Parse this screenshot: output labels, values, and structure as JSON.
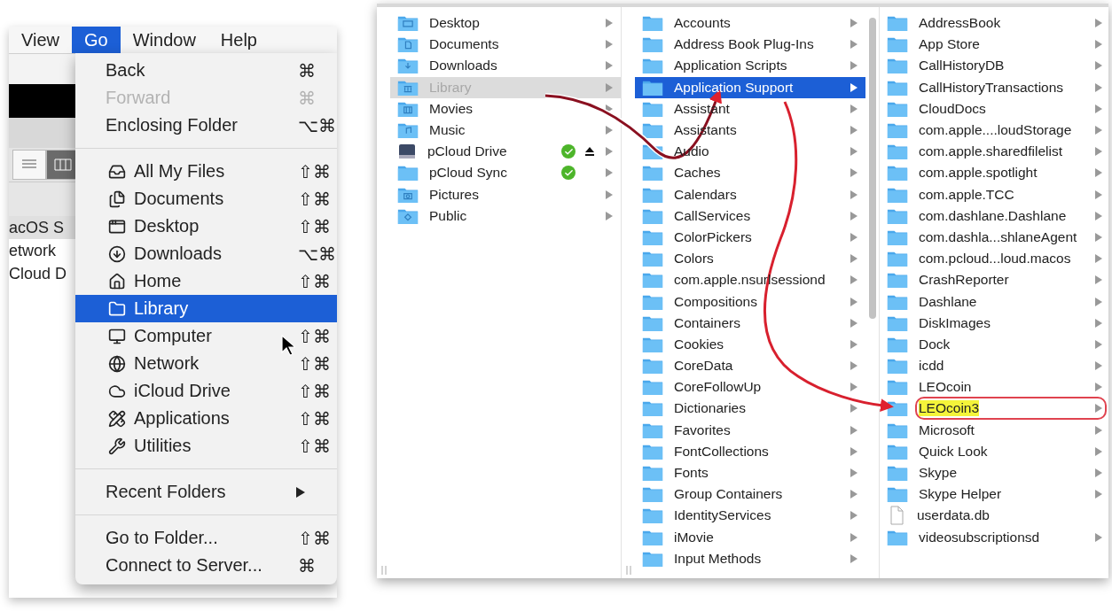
{
  "menu_bar": [
    {
      "label": "View",
      "selected": false
    },
    {
      "label": "Go",
      "selected": true
    },
    {
      "label": "Window",
      "selected": false
    },
    {
      "label": "Help",
      "selected": false
    }
  ],
  "background_window": {
    "view_buttons": [
      {
        "kind": "list",
        "selected": false
      },
      {
        "kind": "columns",
        "selected": true
      }
    ],
    "sidebar": [
      {
        "label": "acOS S",
        "selected": true
      },
      {
        "label": "etwork",
        "selected": false
      },
      {
        "label": "Cloud D",
        "selected": false
      }
    ]
  },
  "go_menu": {
    "sections": [
      [
        {
          "label": "Back",
          "shortcut": "⌘",
          "selected": false,
          "disabled": false,
          "submenu": false
        },
        {
          "label": "Forward",
          "shortcut": "⌘",
          "selected": false,
          "disabled": true,
          "submenu": false
        },
        {
          "label": "Enclosing Folder",
          "shortcut": "⌥⌘",
          "selected": false,
          "disabled": false,
          "submenu": false
        }
      ],
      [
        {
          "label": "All My Files",
          "shortcut": "⇧⌘",
          "selected": false,
          "disabled": false,
          "submenu": false
        },
        {
          "label": "Documents",
          "shortcut": "⇧⌘",
          "selected": false,
          "disabled": false,
          "submenu": false
        },
        {
          "label": "Desktop",
          "shortcut": "⇧⌘",
          "selected": false,
          "disabled": false,
          "submenu": false
        },
        {
          "label": "Downloads",
          "shortcut": "⌥⌘",
          "selected": false,
          "disabled": false,
          "submenu": false
        },
        {
          "label": "Home",
          "shortcut": "⇧⌘",
          "selected": false,
          "disabled": false,
          "submenu": false
        },
        {
          "label": "Library",
          "selected": true,
          "disabled": false,
          "submenu": false
        },
        {
          "label": "Computer",
          "shortcut": "⇧⌘",
          "selected": false,
          "disabled": false,
          "submenu": false
        },
        {
          "label": "Network",
          "shortcut": "⇧⌘",
          "selected": false,
          "disabled": false,
          "submenu": false
        },
        {
          "label": "iCloud Drive",
          "shortcut": "⇧⌘",
          "selected": false,
          "disabled": false,
          "submenu": false
        },
        {
          "label": "Applications",
          "shortcut": "⇧⌘",
          "selected": false,
          "disabled": false,
          "submenu": false
        },
        {
          "label": "Utilities",
          "shortcut": "⇧⌘",
          "selected": false,
          "disabled": false,
          "submenu": false
        }
      ],
      [
        {
          "label": "Recent Folders",
          "selected": false,
          "disabled": false,
          "submenu": true
        }
      ],
      [
        {
          "label": "Go to Folder...",
          "shortcut": "⇧⌘",
          "selected": false,
          "disabled": false,
          "submenu": false
        },
        {
          "label": "Connect to Server...",
          "shortcut": "⌘",
          "selected": false,
          "disabled": false,
          "submenu": false
        }
      ]
    ]
  },
  "finder_columns": [
    {
      "focused": false,
      "scrollbar": false,
      "items": [
        {
          "name": "Desktop",
          "kind": "desktop",
          "selected": false,
          "has_children": true,
          "synced": false,
          "ejectable": false
        },
        {
          "name": "Documents",
          "kind": "documents",
          "selected": false,
          "has_children": true,
          "synced": false,
          "ejectable": false
        },
        {
          "name": "Downloads",
          "kind": "downloads",
          "selected": false,
          "has_children": true,
          "synced": false,
          "ejectable": false
        },
        {
          "name": "Library",
          "kind": "library",
          "selected": true,
          "has_children": true,
          "synced": false,
          "ejectable": false
        },
        {
          "name": "Movies",
          "kind": "movies",
          "selected": false,
          "has_children": true,
          "synced": false,
          "ejectable": false
        },
        {
          "name": "Music",
          "kind": "music",
          "selected": false,
          "has_children": true,
          "synced": false,
          "ejectable": false
        },
        {
          "name": "pCloud Drive",
          "kind": "drive",
          "selected": false,
          "has_children": true,
          "synced": true,
          "ejectable": true
        },
        {
          "name": "pCloud Sync",
          "kind": "folder",
          "selected": false,
          "has_children": true,
          "synced": true,
          "ejectable": false
        },
        {
          "name": "Pictures",
          "kind": "pictures",
          "selected": false,
          "has_children": true,
          "synced": false,
          "ejectable": false
        },
        {
          "name": "Public",
          "kind": "public",
          "selected": false,
          "has_children": true,
          "synced": false,
          "ejectable": false
        }
      ]
    },
    {
      "focused": true,
      "scrollbar": true,
      "items": [
        {
          "name": "Accounts",
          "kind": "folder",
          "selected": false,
          "has_children": true
        },
        {
          "name": "Address Book Plug-Ins",
          "kind": "folder",
          "selected": false,
          "has_children": true
        },
        {
          "name": "Application Scripts",
          "kind": "folder",
          "selected": false,
          "has_children": true
        },
        {
          "name": "Application Support",
          "kind": "folder",
          "selected": true,
          "has_children": true
        },
        {
          "name": "Assistant",
          "kind": "folder",
          "selected": false,
          "has_children": true
        },
        {
          "name": "Assistants",
          "kind": "folder",
          "selected": false,
          "has_children": true
        },
        {
          "name": "Audio",
          "kind": "folder",
          "selected": false,
          "has_children": true
        },
        {
          "name": "Caches",
          "kind": "folder",
          "selected": false,
          "has_children": true
        },
        {
          "name": "Calendars",
          "kind": "folder",
          "selected": false,
          "has_children": true
        },
        {
          "name": "CallServices",
          "kind": "folder",
          "selected": false,
          "has_children": true
        },
        {
          "name": "ColorPickers",
          "kind": "folder",
          "selected": false,
          "has_children": true
        },
        {
          "name": "Colors",
          "kind": "folder",
          "selected": false,
          "has_children": true
        },
        {
          "name": "com.apple.nsurlsessiond",
          "kind": "folder",
          "selected": false,
          "has_children": true
        },
        {
          "name": "Compositions",
          "kind": "folder",
          "selected": false,
          "has_children": true
        },
        {
          "name": "Containers",
          "kind": "folder",
          "selected": false,
          "has_children": true
        },
        {
          "name": "Cookies",
          "kind": "folder",
          "selected": false,
          "has_children": true
        },
        {
          "name": "CoreData",
          "kind": "folder",
          "selected": false,
          "has_children": true
        },
        {
          "name": "CoreFollowUp",
          "kind": "folder",
          "selected": false,
          "has_children": true
        },
        {
          "name": "Dictionaries",
          "kind": "folder",
          "selected": false,
          "has_children": true
        },
        {
          "name": "Favorites",
          "kind": "folder",
          "selected": false,
          "has_children": true
        },
        {
          "name": "FontCollections",
          "kind": "folder",
          "selected": false,
          "has_children": true
        },
        {
          "name": "Fonts",
          "kind": "folder",
          "selected": false,
          "has_children": true
        },
        {
          "name": "Group Containers",
          "kind": "folder",
          "selected": false,
          "has_children": true
        },
        {
          "name": "IdentityServices",
          "kind": "folder",
          "selected": false,
          "has_children": true
        },
        {
          "name": "iMovie",
          "kind": "folder",
          "selected": false,
          "has_children": true
        },
        {
          "name": "Input Methods",
          "kind": "folder",
          "selected": false,
          "has_children": true
        }
      ]
    },
    {
      "scrollbar": false,
      "items": [
        {
          "name": "AddressBook",
          "kind": "folder",
          "selected": false,
          "has_children": true,
          "highlighted": false
        },
        {
          "name": "App Store",
          "kind": "folder",
          "selected": false,
          "has_children": true,
          "highlighted": false
        },
        {
          "name": "CallHistoryDB",
          "kind": "folder",
          "selected": false,
          "has_children": true,
          "highlighted": false
        },
        {
          "name": "CallHistoryTransactions",
          "kind": "folder",
          "selected": false,
          "has_children": true,
          "highlighted": false
        },
        {
          "name": "CloudDocs",
          "kind": "folder",
          "selected": false,
          "has_children": true,
          "highlighted": false
        },
        {
          "name": "com.apple....loudStorage",
          "kind": "folder",
          "selected": false,
          "has_children": true,
          "highlighted": false
        },
        {
          "name": "com.apple.sharedfilelist",
          "kind": "folder",
          "selected": false,
          "has_children": true,
          "highlighted": false
        },
        {
          "name": "com.apple.spotlight",
          "kind": "folder",
          "selected": false,
          "has_children": true,
          "highlighted": false
        },
        {
          "name": "com.apple.TCC",
          "kind": "folder",
          "selected": false,
          "has_children": true,
          "highlighted": false
        },
        {
          "name": "com.dashlane.Dashlane",
          "kind": "folder",
          "selected": false,
          "has_children": true,
          "highlighted": false
        },
        {
          "name": "com.dashla...shlaneAgent",
          "kind": "folder",
          "selected": false,
          "has_children": true,
          "highlighted": false
        },
        {
          "name": "com.pcloud...loud.macos",
          "kind": "folder",
          "selected": false,
          "has_children": true,
          "highlighted": false
        },
        {
          "name": "CrashReporter",
          "kind": "folder",
          "selected": false,
          "has_children": true,
          "highlighted": false
        },
        {
          "name": "Dashlane",
          "kind": "folder",
          "selected": false,
          "has_children": true,
          "highlighted": false
        },
        {
          "name": "DiskImages",
          "kind": "folder",
          "selected": false,
          "has_children": true,
          "highlighted": false
        },
        {
          "name": "Dock",
          "kind": "folder",
          "selected": false,
          "has_children": true,
          "highlighted": false
        },
        {
          "name": "icdd",
          "kind": "folder",
          "selected": false,
          "has_children": true,
          "highlighted": false
        },
        {
          "name": "LEOcoin",
          "kind": "folder",
          "selected": false,
          "has_children": true,
          "highlighted": false
        },
        {
          "name": "LEOcoin3",
          "kind": "folder",
          "selected": false,
          "has_children": true,
          "highlighted": true
        },
        {
          "name": "Microsoft",
          "kind": "folder",
          "selected": false,
          "has_children": true,
          "highlighted": false
        },
        {
          "name": "Quick Look",
          "kind": "folder",
          "selected": false,
          "has_children": true,
          "highlighted": false
        },
        {
          "name": "Skype",
          "kind": "folder",
          "selected": false,
          "has_children": true,
          "highlighted": false
        },
        {
          "name": "Skype Helper",
          "kind": "folder",
          "selected": false,
          "has_children": true,
          "highlighted": false
        },
        {
          "name": "userdata.db",
          "kind": "file",
          "selected": false,
          "has_children": false,
          "highlighted": false
        },
        {
          "name": "videosubscriptionsd",
          "kind": "folder",
          "selected": false,
          "has_children": true,
          "highlighted": false
        }
      ]
    }
  ]
}
